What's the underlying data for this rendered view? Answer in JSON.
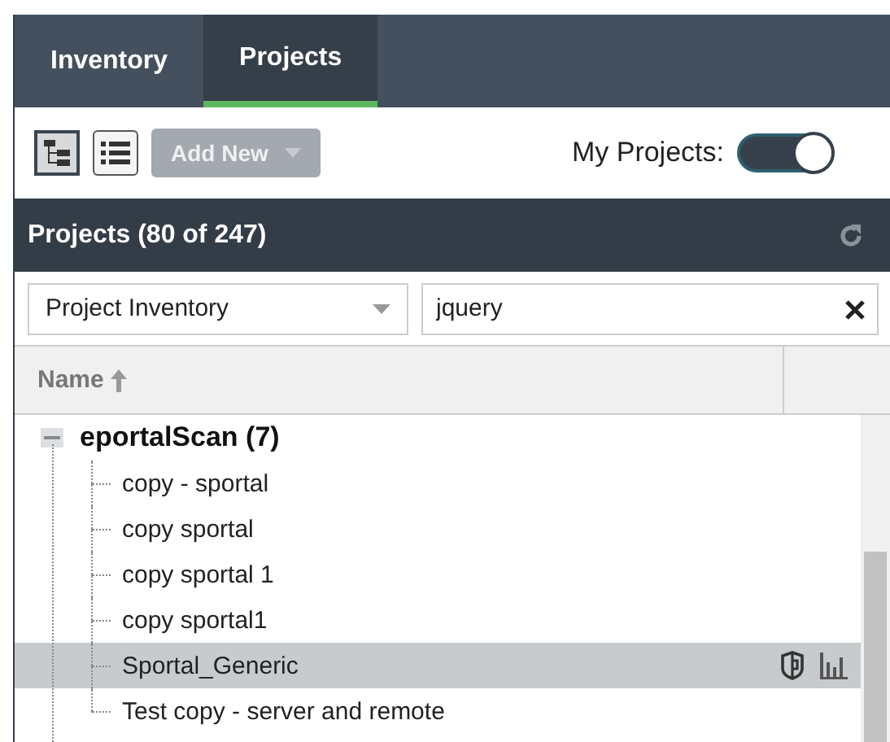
{
  "tabs": [
    {
      "label": "Inventory",
      "selected": false
    },
    {
      "label": "Projects",
      "selected": true
    }
  ],
  "toolbar": {
    "views": [
      {
        "kind": "tree",
        "selected": true
      },
      {
        "kind": "list",
        "selected": false
      }
    ],
    "add_button": {
      "label": "Add New",
      "disabled": true
    },
    "my_projects": {
      "label": "My Projects:",
      "on": true
    }
  },
  "panel": {
    "title": "Projects (80 of 247)"
  },
  "filter": {
    "scope": "Project Inventory",
    "search": "jquery"
  },
  "table": {
    "columns": [
      "Name"
    ],
    "tree": [
      {
        "label": "eportalScan (7)",
        "expanded": true,
        "selected": false,
        "children": [
          {
            "label": "copy - sportal",
            "selected": false
          },
          {
            "label": "copy sportal",
            "selected": false
          },
          {
            "label": "copy sportal 1",
            "selected": false
          },
          {
            "label": "copy sportal1",
            "selected": false
          },
          {
            "label": "Sportal_Generic",
            "selected": true
          },
          {
            "label": "Test copy - server and remote",
            "selected": false
          }
        ]
      }
    ]
  }
}
